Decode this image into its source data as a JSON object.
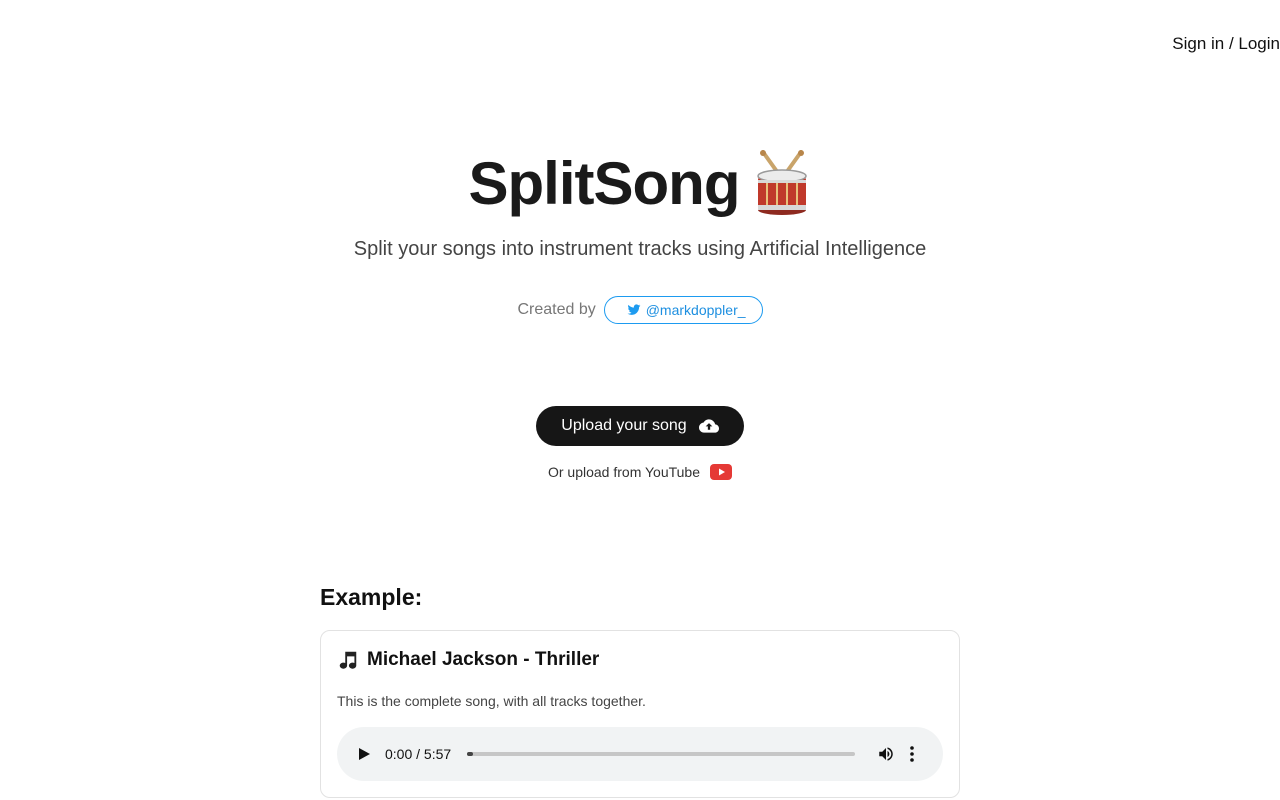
{
  "header": {
    "signin_label": "Sign in / Login"
  },
  "hero": {
    "title": "SplitSong",
    "title_icon": "drum-icon",
    "subtitle": "Split your songs into instrument tracks using Artificial Intelligence",
    "created_by_label": "Created by",
    "twitter_handle": "@markdoppler_",
    "twitter_icon": "twitter-bird-icon"
  },
  "upload": {
    "button_label": "Upload your song",
    "button_icon": "cloud-upload-icon",
    "youtube_label": "Or upload from YouTube",
    "youtube_icon": "youtube-icon"
  },
  "example": {
    "heading": "Example:",
    "song_icon": "music-note-icon",
    "song_title": "Michael Jackson - Thriller",
    "description": "This is the complete song, with all tracks together.",
    "player": {
      "time": "0:00 / 5:57",
      "progress": 0.0
    }
  },
  "colors": {
    "upload_button_bg": "#161616",
    "twitter_blue": "#1d9bf0",
    "youtube_red": "#e53935",
    "player_bg": "#f1f3f4"
  }
}
